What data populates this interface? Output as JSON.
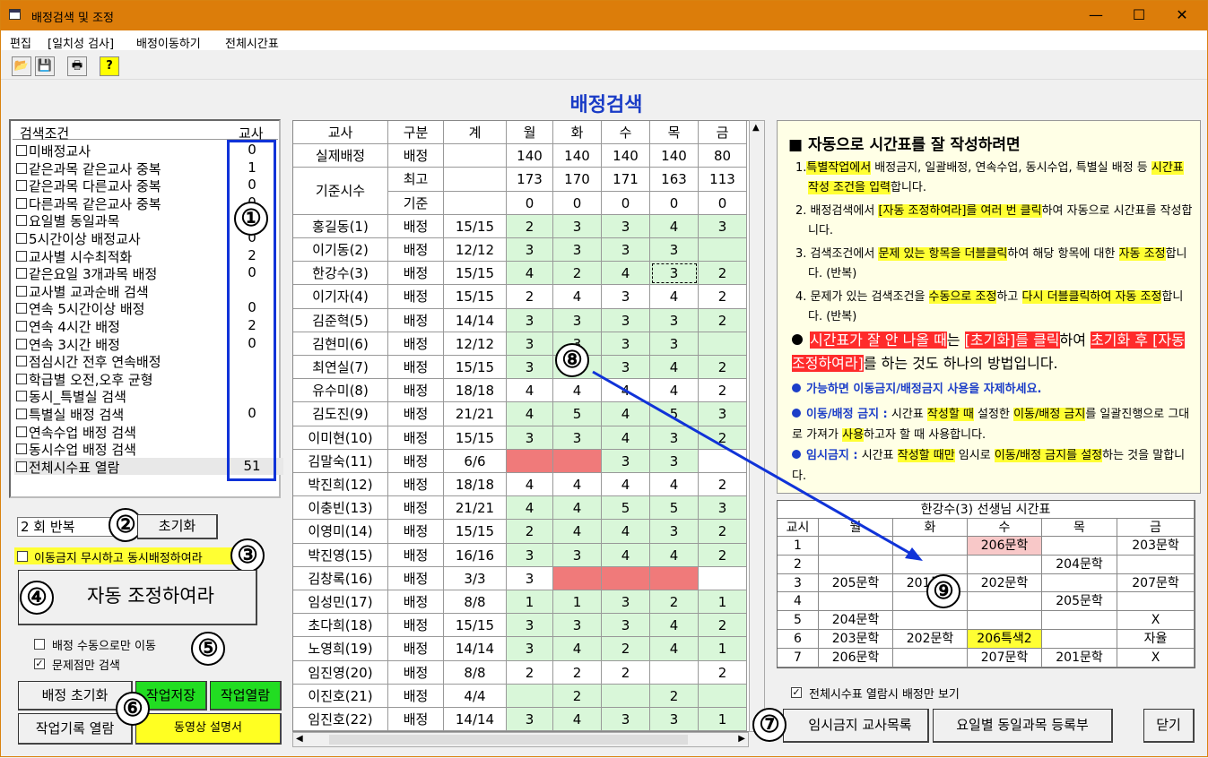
{
  "window": {
    "title": "배정검색 및 조정"
  },
  "menu": [
    "편집",
    "[일치성 검사]",
    "배정이동하기",
    "전체시간표"
  ],
  "heading": "배정검색",
  "conditions": {
    "header_label": "검색조건",
    "header_count": "교사",
    "items": [
      {
        "label": "미배정교사",
        "count": "0"
      },
      {
        "label": "같은과목 같은교사 중복",
        "count": "1"
      },
      {
        "label": "같은과목 다른교사 중복",
        "count": "0"
      },
      {
        "label": "다른과목 같은교사 중복",
        "count": "0"
      },
      {
        "label": "요일별 동일과목",
        "count": ""
      },
      {
        "label": "5시간이상 배정교사",
        "count": "0"
      },
      {
        "label": "교사별 시수최적화",
        "count": "2"
      },
      {
        "label": "같은요일 3개과목 배정",
        "count": "0"
      },
      {
        "label": "교사별 교과순배 검색",
        "count": ""
      },
      {
        "label": "연속 5시간이상 배정",
        "count": "0"
      },
      {
        "label": "연속 4시간 배정",
        "count": "2"
      },
      {
        "label": "연속 3시간 배정",
        "count": "0"
      },
      {
        "label": "점심시간 전후 연속배정",
        "count": ""
      },
      {
        "label": "학급별 오전,오후 균형",
        "count": ""
      },
      {
        "label": "동시_특별실 검색",
        "count": ""
      },
      {
        "label": "특별실 배정 검색",
        "count": "0"
      },
      {
        "label": "연속수업 배정 검색",
        "count": ""
      },
      {
        "label": "동시수업 배정 검색",
        "count": ""
      },
      {
        "label": "전체시수표 열람",
        "count": "51"
      }
    ]
  },
  "controls": {
    "repeat_value": "2 회 반복",
    "reset": "초기화",
    "ignore_label": "이동금지 무시하고 동시배정하여라",
    "auto_adjust": "자동 조정하여라",
    "manual_move": "배정 수동으로만 이동",
    "problem_only": "문제점만 검색",
    "assign_reset": "배정 초기화",
    "save_work": "작업저장",
    "open_work": "작업열람",
    "open_log": "작업기록 열람",
    "video_manual": "동영상 설명서",
    "view_full_only": "전체시수표 열람시 배정만 보기",
    "temp_ban": "임시금지 교사목록",
    "weekday_reg": "요일별 동일과목 등록부",
    "close": "닫기"
  },
  "numbers": [
    "①",
    "②",
    "③",
    "④",
    "⑤",
    "⑥",
    "⑦",
    "⑧",
    "⑨"
  ],
  "grid": {
    "headers": [
      "교사",
      "구분",
      "계",
      "월",
      "화",
      "수",
      "목",
      "금"
    ],
    "actual": {
      "label": "실제배정",
      "kind": "배정",
      "values": [
        "140",
        "140",
        "140",
        "140",
        "80"
      ]
    },
    "standard": {
      "label": "기준시수",
      "max_label": "최고",
      "max": [
        "173",
        "170",
        "171",
        "163",
        "113"
      ],
      "base_label": "기준",
      "base": [
        "0",
        "0",
        "0",
        "0",
        "0"
      ]
    },
    "rows": [
      [
        "홍길동(1)",
        "배정",
        "15/15",
        "2",
        "3",
        "3",
        "4",
        "3"
      ],
      [
        "이기동(2)",
        "배정",
        "12/12",
        "3",
        "3",
        "3",
        "3",
        ""
      ],
      [
        "한강수(3)",
        "배정",
        "15/15",
        "4",
        "2",
        "4",
        "3",
        "2"
      ],
      [
        "이기자(4)",
        "배정",
        "15/15",
        "2",
        "4",
        "3",
        "4",
        "2"
      ],
      [
        "김준혁(5)",
        "배정",
        "14/14",
        "3",
        "3",
        "3",
        "3",
        "2"
      ],
      [
        "김현미(6)",
        "배정",
        "12/12",
        "3",
        "3",
        "3",
        "3",
        ""
      ],
      [
        "최연실(7)",
        "배정",
        "15/15",
        "3",
        "3",
        "3",
        "4",
        "2"
      ],
      [
        "유수미(8)",
        "배정",
        "18/18",
        "4",
        "4",
        "4",
        "4",
        "2"
      ],
      [
        "김도진(9)",
        "배정",
        "21/21",
        "4",
        "5",
        "4",
        "5",
        "3"
      ],
      [
        "이미현(10)",
        "배정",
        "15/15",
        "3",
        "3",
        "4",
        "3",
        "2"
      ],
      [
        "김말숙(11)",
        "배정",
        "6/6",
        "",
        "",
        "3",
        "3",
        ""
      ],
      [
        "박진희(12)",
        "배정",
        "18/18",
        "4",
        "4",
        "4",
        "4",
        "2"
      ],
      [
        "이충빈(13)",
        "배정",
        "21/21",
        "4",
        "4",
        "5",
        "5",
        "3"
      ],
      [
        "이영미(14)",
        "배정",
        "15/15",
        "2",
        "4",
        "4",
        "3",
        "2"
      ],
      [
        "박진영(15)",
        "배정",
        "16/16",
        "3",
        "3",
        "4",
        "4",
        "2"
      ],
      [
        "김창록(16)",
        "배정",
        "3/3",
        "3",
        "",
        "",
        "",
        ""
      ],
      [
        "임성민(17)",
        "배정",
        "8/8",
        "1",
        "1",
        "3",
        "2",
        "1"
      ],
      [
        "초다희(18)",
        "배정",
        "15/15",
        "3",
        "3",
        "3",
        "4",
        "2"
      ],
      [
        "노영희(19)",
        "배정",
        "14/14",
        "3",
        "4",
        "2",
        "4",
        "1"
      ],
      [
        "임진영(20)",
        "배정",
        "8/8",
        "2",
        "2",
        "2",
        "",
        "2"
      ],
      [
        "이진호(21)",
        "배정",
        "4/4",
        "",
        "2",
        "",
        "2",
        ""
      ],
      [
        "임진호(22)",
        "배정",
        "14/14",
        "3",
        "4",
        "3",
        "3",
        "1"
      ]
    ]
  },
  "info": {
    "title": "자동으로 시간표를 잘 작성하려면",
    "steps": [
      [
        "1.",
        {
          "h": "특별작업에서"
        },
        " 배정금지, 일괄배정, 연속수업, 동시수업, 특별실 배정 등 ",
        {
          "h": "시간표 작성 조건을 입력"
        },
        "합니다."
      ],
      [
        "2. 배정검색에서 ",
        {
          "h": "[자동 조정하여라]를 여러 번 클릭"
        },
        "하여 자동으로 시간표를 작성합니다."
      ],
      [
        "3. 검색조건에서 ",
        {
          "h": "문제 있는 항목을 더블클릭"
        },
        "하여 해당 항목에 대한 ",
        {
          "h": "자동 조정"
        },
        "합니다. (반복)"
      ],
      [
        "4. 문제가 있는 검색조건을 ",
        {
          "h": "수동으로 조정"
        },
        "하고 ",
        {
          "h": "다시 더블클릭하여 자동 조정"
        },
        "합니다. (반복)"
      ]
    ],
    "tip_big": [
      {
        "r": "시간표가 잘 안 나올 때"
      },
      "는 ",
      {
        "r": "[초기화]를 클릭"
      },
      "하여 ",
      {
        "r": "초기화 후 [자동 조정하여라]"
      },
      "를 하는 것도 하나의 방법입니다."
    ],
    "tip2": "가능하면 이동금지/배정금지 사용을 자제하세요.",
    "tip3": [
      {
        "b": "이동/배정 금지 :"
      },
      " 시간표 ",
      {
        "h": "작성할 때"
      },
      " 설정한 ",
      {
        "h": "이동/배정 금지"
      },
      "를 일괄진행으로 그대로 가져가 ",
      {
        "h": "사용"
      },
      "하고자 할 때 사용합니다."
    ],
    "tip4": [
      {
        "b": "임시금지 :"
      },
      " 시간표 ",
      {
        "h": "작성할 때만"
      },
      " 임시로 ",
      {
        "h": "이동/배정 금지를 설정"
      },
      "하는 것을 말합니다."
    ]
  },
  "timetable": {
    "title": "한강수(3) 선생님 시간표",
    "headers": [
      "교시",
      "월",
      "화",
      "수",
      "목",
      "금"
    ],
    "rows": [
      [
        "1",
        "",
        "",
        "206문학",
        "",
        "203문학"
      ],
      [
        "2",
        "",
        "",
        "",
        "204문학",
        ""
      ],
      [
        "3",
        "205문학",
        "201문학",
        "202문학",
        "",
        "207문학"
      ],
      [
        "4",
        "",
        "",
        "",
        "205문학",
        ""
      ],
      [
        "5",
        "204문학",
        "",
        "",
        "",
        "X"
      ],
      [
        "6",
        "203문학",
        "202문학",
        "206특색2",
        "",
        "자율"
      ],
      [
        "7",
        "206문학",
        "",
        "207문학",
        "201문학",
        "X"
      ]
    ]
  }
}
